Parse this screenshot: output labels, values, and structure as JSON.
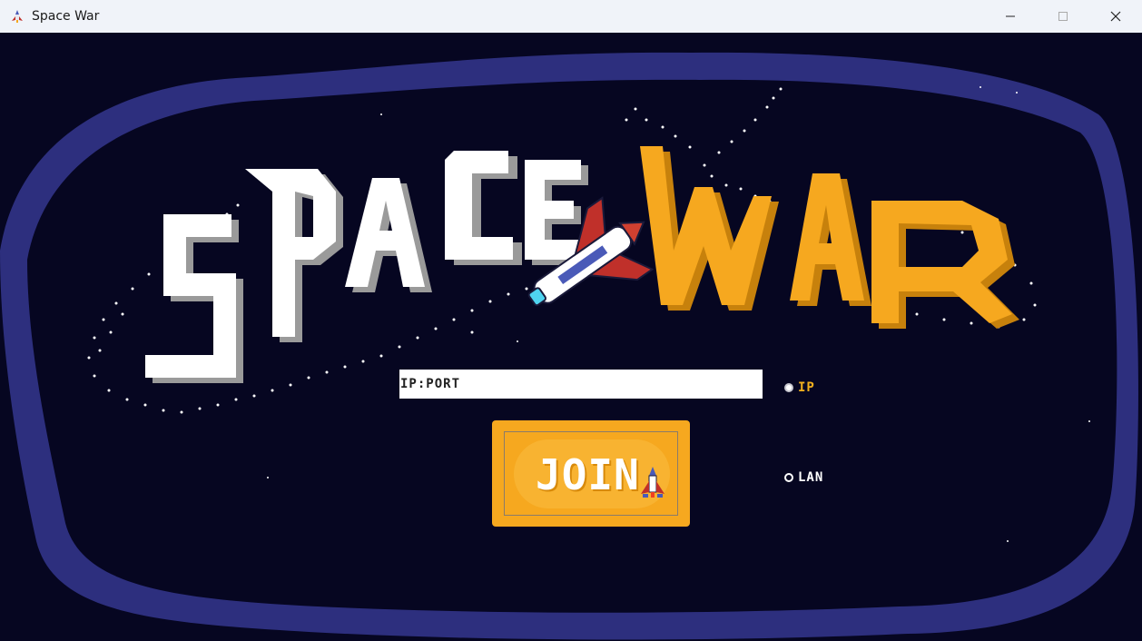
{
  "window": {
    "title": "Space War"
  },
  "title_art": {
    "word_1": "SPACE",
    "word_2": "WAR"
  },
  "connect": {
    "ip_placeholder": "IP:PORT",
    "ip_value": "",
    "join_label": "JOIN"
  },
  "mode_options": [
    {
      "label": "IP",
      "selected": true
    },
    {
      "label": "LAN",
      "selected": false
    }
  ],
  "colors": {
    "space_bg": "#060621",
    "nebula_border": "#3a3f9c",
    "accent_orange": "#f6a81f",
    "label_yellow": "#f2b01e",
    "label_white": "#ffffff"
  },
  "icons": {
    "app": "rocket-icon",
    "minimize": "minimize-icon",
    "maximize": "maximize-icon",
    "close": "close-icon",
    "join_ship": "spaceship-icon"
  }
}
